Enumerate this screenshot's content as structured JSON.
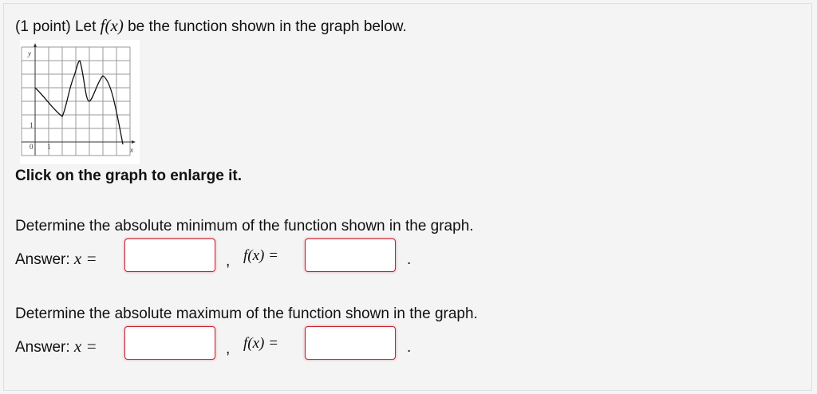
{
  "problem": {
    "intro_prefix": "(1 point) Let ",
    "intro_fx": "f(x)",
    "intro_suffix": " be the function shown in the graph below.",
    "graph_hint": "Click on the graph to enlarge it.",
    "graph": {
      "y_axis_label": "y",
      "x_axis_label": "x",
      "origin_label": "0",
      "x_unit_label": "1",
      "y_unit_label": "1"
    }
  },
  "minimum": {
    "question": "Determine the absolute minimum of the function shown in the graph.",
    "answer_label": "Answer:",
    "x_eq": "x =",
    "comma": ",",
    "fx_eq": "f(x) =",
    "period": ".",
    "x_value": "",
    "fx_value": ""
  },
  "maximum": {
    "question": "Determine the absolute maximum of the function shown in the graph.",
    "answer_label": "Answer:",
    "x_eq": "x =",
    "comma": ",",
    "fx_eq": "f(x) =",
    "period": ".",
    "x_value": "",
    "fx_value": ""
  }
}
